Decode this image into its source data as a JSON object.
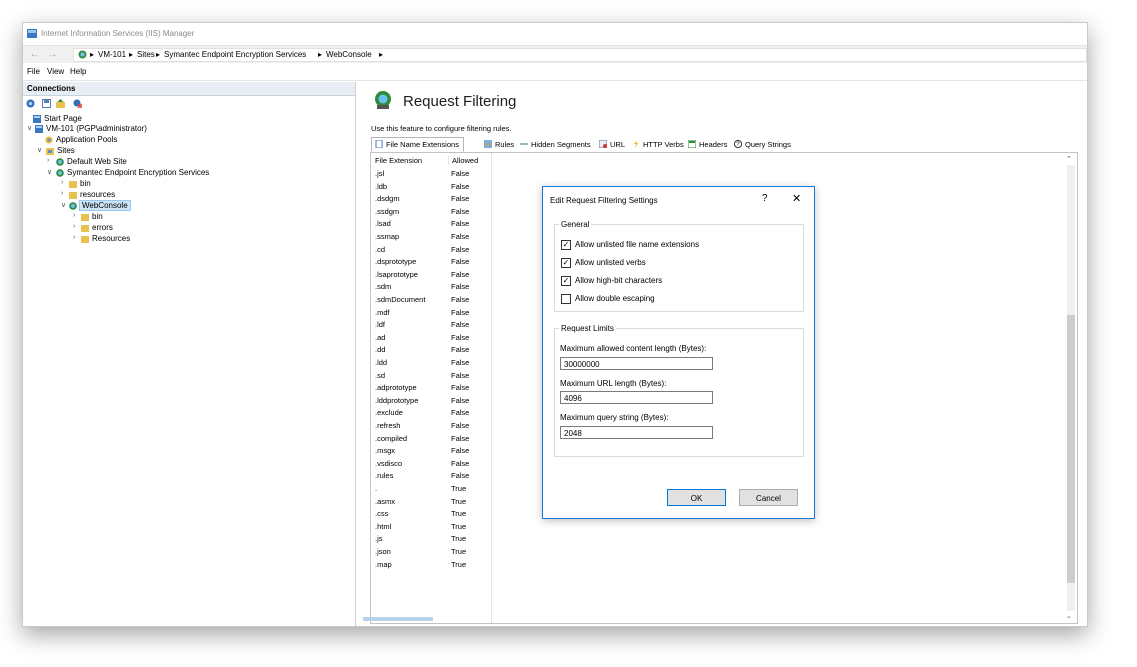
{
  "window": {
    "title": "Internet Information Services (IIS) Manager"
  },
  "address": {
    "segments": [
      "VM-101",
      "Sites",
      "Symantec Endpoint Encryption Services",
      "WebConsole"
    ],
    "separator": "▸"
  },
  "menu": {
    "items": [
      "File",
      "View",
      "Help"
    ]
  },
  "connections": {
    "header": "Connections",
    "tree": [
      {
        "label": "Start Page"
      },
      {
        "label": "VM-101 (PGP\\administrator)"
      },
      {
        "label": "Application Pools"
      },
      {
        "label": "Sites"
      },
      {
        "label": "Default Web Site"
      },
      {
        "label": "Symantec Endpoint Encryption Services"
      },
      {
        "label": "bin"
      },
      {
        "label": "resources"
      },
      {
        "label": "WebConsole"
      },
      {
        "label": "bin"
      },
      {
        "label": "errors"
      },
      {
        "label": "Resources"
      }
    ]
  },
  "feature": {
    "title": "Request Filtering",
    "description": "Use this feature to configure filtering rules.",
    "tabs": [
      {
        "label": "File Name Extensions",
        "icon": "file-icon"
      },
      {
        "label": "Rules",
        "icon": "rules-icon"
      },
      {
        "label": "Hidden Segments",
        "icon": "hidden-segments-icon"
      },
      {
        "label": "URL",
        "icon": "url-icon"
      },
      {
        "label": "HTTP Verbs",
        "icon": "http-verbs-icon"
      },
      {
        "label": "Headers",
        "icon": "headers-icon"
      },
      {
        "label": "Query Strings",
        "icon": "query-strings-icon"
      }
    ],
    "table": {
      "headers": [
        "File Extension",
        "Allowed"
      ],
      "rows": [
        [
          ".jsl",
          "False"
        ],
        [
          ".ldb",
          "False"
        ],
        [
          ".dsdgm",
          "False"
        ],
        [
          ".ssdgm",
          "False"
        ],
        [
          ".lsad",
          "False"
        ],
        [
          ".ssmap",
          "False"
        ],
        [
          ".cd",
          "False"
        ],
        [
          ".dsprototype",
          "False"
        ],
        [
          ".lsaprototype",
          "False"
        ],
        [
          ".sdm",
          "False"
        ],
        [
          ".sdmDocument",
          "False"
        ],
        [
          ".mdf",
          "False"
        ],
        [
          ".ldf",
          "False"
        ],
        [
          ".ad",
          "False"
        ],
        [
          ".dd",
          "False"
        ],
        [
          ".ldd",
          "False"
        ],
        [
          ".sd",
          "False"
        ],
        [
          ".adprototype",
          "False"
        ],
        [
          ".lddprototype",
          "False"
        ],
        [
          ".exclude",
          "False"
        ],
        [
          ".refresh",
          "False"
        ],
        [
          ".compiled",
          "False"
        ],
        [
          ".msgx",
          "False"
        ],
        [
          ".vsdisco",
          "False"
        ],
        [
          ".rules",
          "False"
        ],
        [
          ".",
          "True"
        ],
        [
          ".asmx",
          "True"
        ],
        [
          ".css",
          "True"
        ],
        [
          ".html",
          "True"
        ],
        [
          ".js",
          "True"
        ],
        [
          ".json",
          "True"
        ],
        [
          ".map",
          "True"
        ]
      ]
    }
  },
  "dialog": {
    "title": "Edit Request Filtering Settings",
    "help": "?",
    "close": "✕",
    "general": {
      "title": "General",
      "options": [
        {
          "label": "Allow unlisted file name extensions",
          "checked": true,
          "mark": "✓"
        },
        {
          "label": "Allow unlisted verbs",
          "checked": true,
          "mark": "✓"
        },
        {
          "label": "Allow high-bit characters",
          "checked": true,
          "mark": "✓"
        },
        {
          "label": "Allow double escaping",
          "checked": false,
          "mark": ""
        }
      ]
    },
    "limits": {
      "title": "Request Limits",
      "content_length_label": "Maximum allowed content length (Bytes):",
      "content_length": "30000000",
      "url_length_label": "Maximum URL length (Bytes):",
      "url_length": "4096",
      "query_length_label": "Maximum query string (Bytes):",
      "query_length": "2048"
    },
    "ok": "OK",
    "cancel": "Cancel"
  }
}
